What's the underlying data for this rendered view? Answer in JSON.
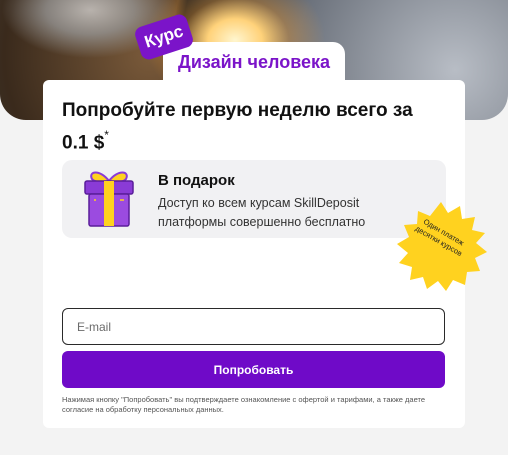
{
  "hero": {
    "badge_label": "Курс",
    "course_title": "Дизайн человека"
  },
  "offer": {
    "headline": "Попробуйте первую неделю всего за 0.1 $",
    "headline_marker": "*"
  },
  "gift": {
    "title": "В подарок",
    "text": "Доступ ко всем курсам SkillDeposit платформы совершенно бесплатно",
    "icon": "gift-icon"
  },
  "sticker": {
    "text": "Один платеж десятки курсов",
    "color": "#FFD21F"
  },
  "form": {
    "email_placeholder": "E-mail",
    "submit_label": "Попробовать",
    "legal_text": "Нажимая кнопку \"Попробовать\" вы подтверждаете ознакомление с офертой и тарифами, а также даете согласие на обработку персональных данных."
  },
  "colors": {
    "accent": "#6F0AC8",
    "card": "#FFFFFF",
    "background": "#F3F3F3"
  }
}
